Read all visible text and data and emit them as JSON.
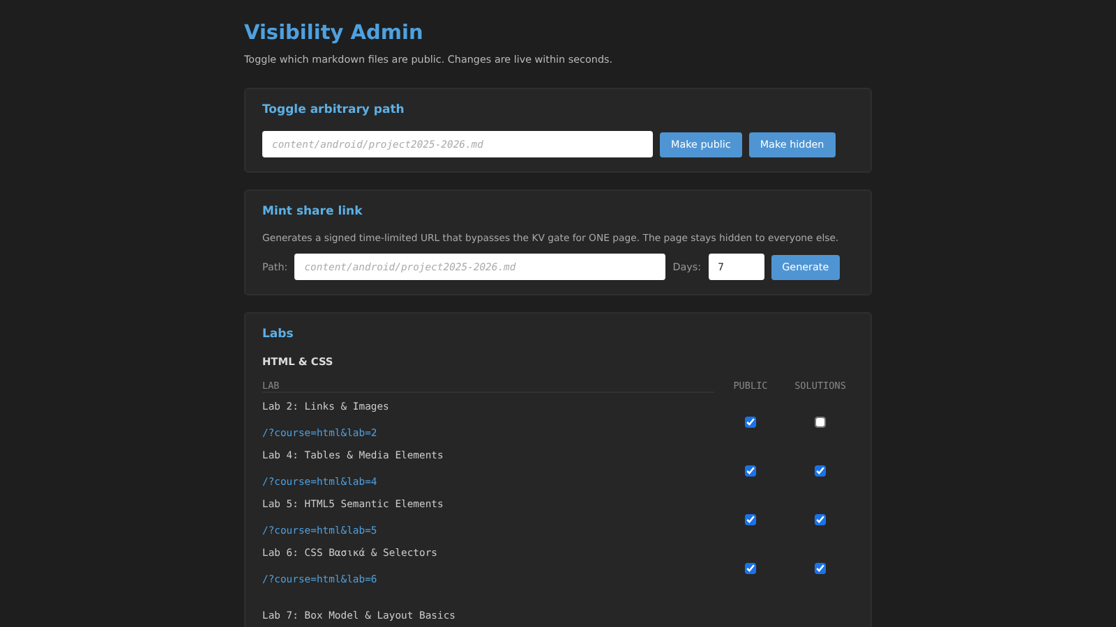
{
  "header": {
    "title": "Visibility Admin",
    "subtitle": "Toggle which markdown files are public. Changes are live within seconds."
  },
  "toggle_card": {
    "title": "Toggle arbitrary path",
    "path_placeholder": "content/android/project2025-2026.md",
    "buttons": [
      "Make public",
      "Make hidden"
    ]
  },
  "share_card": {
    "title": "Mint share link",
    "description": "Generates a signed time-limited URL that bypasses the KV gate for ONE page. The page stays hidden to everyone else.",
    "path_label": "Path:",
    "path_placeholder": "content/android/project2025-2026.md",
    "days_label": "Days:",
    "days_value": "7",
    "button": "Generate"
  },
  "labs_card": {
    "title": "Labs",
    "group": "HTML & CSS",
    "columns": [
      "LAB",
      "PUBLIC",
      "SOLUTIONS"
    ],
    "rows": [
      {
        "title": "Lab 2: Links & Images",
        "link": "/?course=html&lab=2",
        "public": true,
        "solutions": false
      },
      {
        "title": "Lab 4: Tables & Media Elements",
        "link": "/?course=html&lab=4",
        "public": true,
        "solutions": true
      },
      {
        "title": "Lab 5: HTML5 Semantic Elements",
        "link": "/?course=html&lab=5",
        "public": true,
        "solutions": true
      },
      {
        "title": "Lab 6: CSS Βασικά & Selectors",
        "link": "/?course=html&lab=6",
        "public": true,
        "solutions": true
      },
      {
        "title": "Lab 7: Box Model & Layout Basics"
      }
    ]
  }
}
